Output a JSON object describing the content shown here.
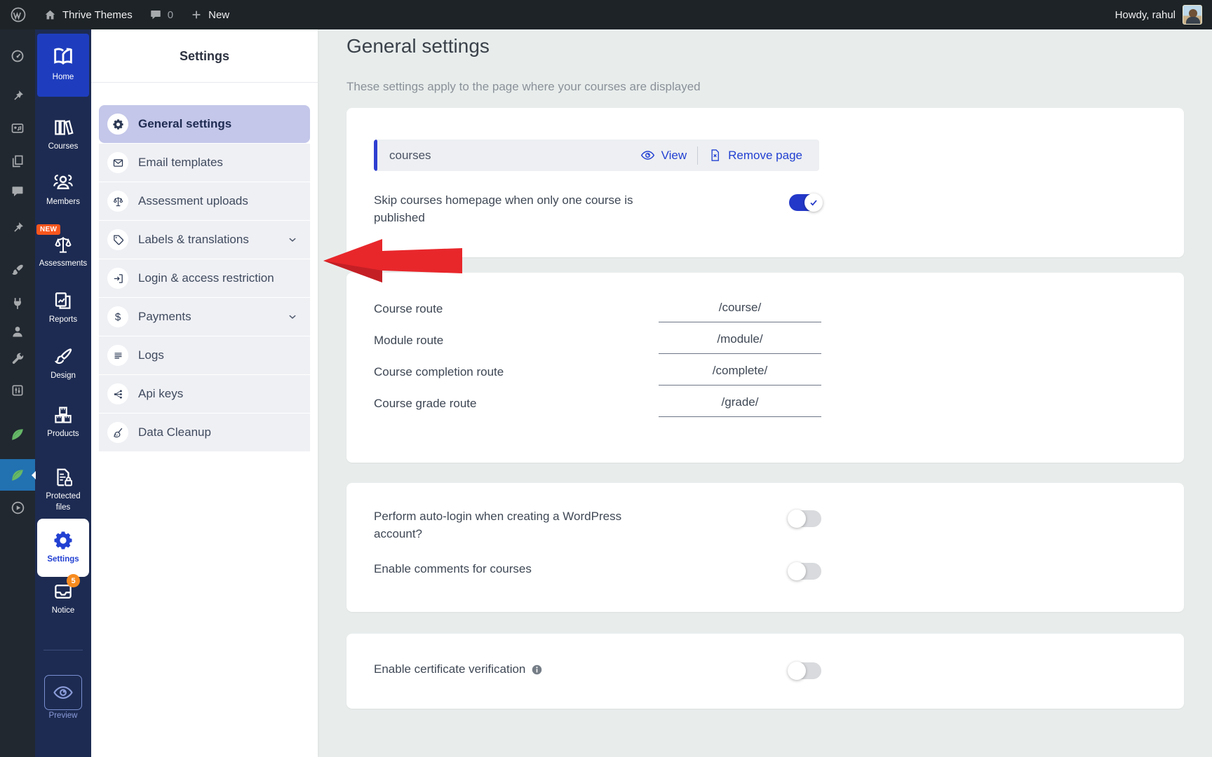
{
  "admin_bar": {
    "site_name": "Thrive Themes",
    "comment_count": "0",
    "new_label": "New",
    "greeting": "Howdy, rahul"
  },
  "wp_sidebar": {
    "icons": [
      "dashboard",
      "pushpin",
      "media",
      "pages",
      "comments",
      "pushpin",
      "brush",
      "plug",
      "user",
      "wrench",
      "sliders",
      "leaf",
      "leaf-active",
      "play"
    ],
    "active_item": "thrive-apprentice"
  },
  "app_sidebar": {
    "items": [
      {
        "label": "Home",
        "icon": "book-logo",
        "active": true
      },
      {
        "label": "Courses",
        "icon": "books"
      },
      {
        "label": "Members",
        "icon": "members"
      },
      {
        "label": "Assessments",
        "icon": "scales",
        "badge": "NEW"
      },
      {
        "label": "Reports",
        "icon": "report"
      },
      {
        "label": "Design",
        "icon": "paintbrush"
      },
      {
        "label": "Products",
        "icon": "boxes"
      },
      {
        "label": "Protected files",
        "icon": "doc-lock"
      },
      {
        "label": "Settings",
        "icon": "gear",
        "active": true
      },
      {
        "label": "Notice",
        "icon": "inbox",
        "badge": "5"
      },
      {
        "label": "Preview",
        "icon": "eye"
      }
    ]
  },
  "settings_nav": {
    "title": "Settings",
    "items": [
      {
        "label": "General settings",
        "icon": "gear",
        "active": true
      },
      {
        "label": "Email templates",
        "icon": "envelope"
      },
      {
        "label": "Assessment uploads",
        "icon": "scales"
      },
      {
        "label": "Labels & translations",
        "icon": "tag",
        "chevron": true
      },
      {
        "label": "Login & access restriction",
        "icon": "login"
      },
      {
        "label": "Payments",
        "icon": "dollar",
        "chevron": true
      },
      {
        "label": "Logs",
        "icon": "lines"
      },
      {
        "label": "Api keys",
        "icon": "api"
      },
      {
        "label": "Data Cleanup",
        "icon": "broom"
      }
    ]
  },
  "main": {
    "title": "General settings",
    "subtitle": "These settings apply to the page where your courses are displayed",
    "page_card": {
      "page_name": "courses",
      "view_label": "View",
      "remove_label": "Remove page",
      "skip_option": {
        "label": "Skip courses homepage when only one course is published",
        "on": true
      }
    },
    "routes": [
      {
        "label": "Course route",
        "value": "/course/"
      },
      {
        "label": "Module route",
        "value": "/module/"
      },
      {
        "label": "Course completion route",
        "value": "/complete/"
      },
      {
        "label": "Course grade route",
        "value": "/grade/"
      }
    ],
    "account_options": [
      {
        "label": "Perform auto-login when creating a WordPress account?",
        "on": false
      },
      {
        "label": "Enable comments for courses",
        "on": false
      }
    ],
    "certificate_option": {
      "label": "Enable certificate verification",
      "on": false
    }
  },
  "colors": {
    "accent_blue": "#2240d2",
    "toggle_on": "#2338c8",
    "sidebar_navy": "#1d2b52",
    "home_tile_blue": "#1e3dbe",
    "wp_selected_blue": "#2271b1",
    "badge_orange": "#f9561d",
    "notice_badge": "#f78b1e",
    "selected_nav_lavender": "#c4c7e9",
    "arrow_red": "#e8272b",
    "content_bg": "#e8edec"
  }
}
